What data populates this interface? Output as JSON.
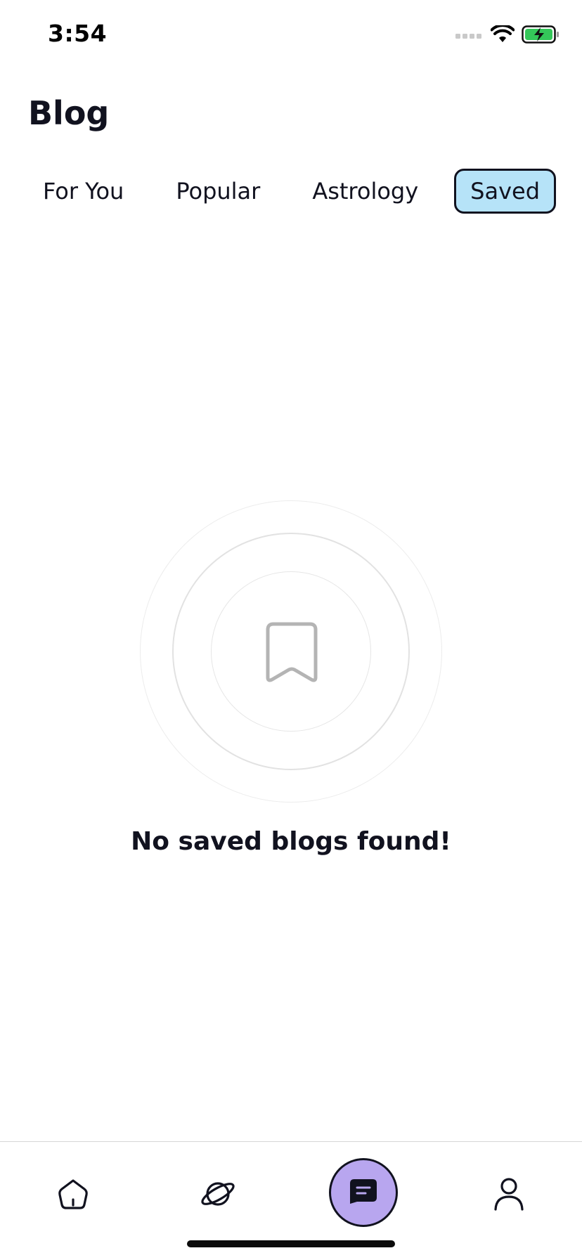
{
  "status_bar": {
    "time": "3:54",
    "icons": [
      "signal-icon",
      "wifi-icon",
      "battery-charging-icon"
    ]
  },
  "header": {
    "title": "Blog"
  },
  "tabs": [
    {
      "label": "For You",
      "active": false
    },
    {
      "label": "Popular",
      "active": false
    },
    {
      "label": "Astrology",
      "active": false
    },
    {
      "label": "Saved",
      "active": true
    }
  ],
  "empty_state": {
    "icon": "bookmark-icon",
    "message": "No saved blogs found!"
  },
  "bottom_nav": {
    "items": [
      {
        "icon": "home-icon",
        "active": false
      },
      {
        "icon": "planet-icon",
        "active": false
      },
      {
        "icon": "blog-icon",
        "active": true
      },
      {
        "icon": "profile-icon",
        "active": false
      }
    ]
  },
  "colors": {
    "text": "#11121f",
    "active_tab_bg": "#b6e3f8",
    "active_nav_bg": "#b8a6ef",
    "battery_green": "#34c759"
  }
}
